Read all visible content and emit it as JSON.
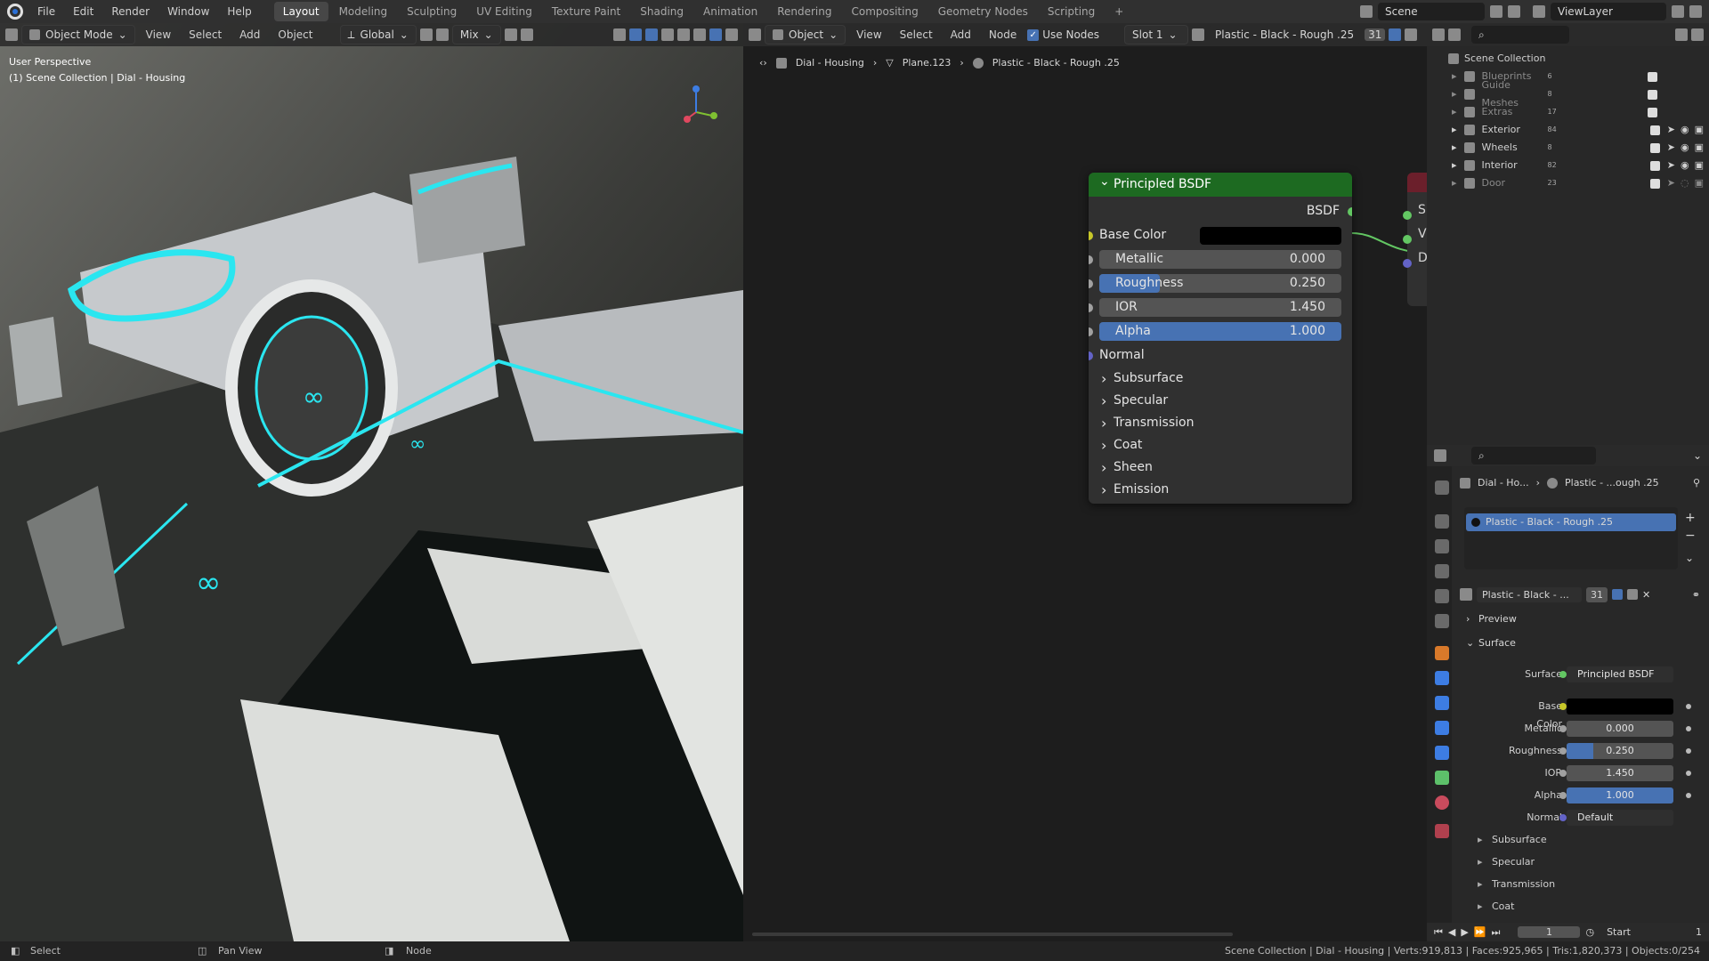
{
  "topbar": {
    "menus": [
      "File",
      "Edit",
      "Render",
      "Window",
      "Help"
    ],
    "workspaces": [
      "Layout",
      "Modeling",
      "Sculpting",
      "UV Editing",
      "Texture Paint",
      "Shading",
      "Animation",
      "Rendering",
      "Compositing",
      "Geometry Nodes",
      "Scripting"
    ],
    "active_workspace": "Layout",
    "add_tab": "+",
    "scene": "Scene",
    "view_layer": "ViewLayer"
  },
  "viewport": {
    "mode": "Object Mode",
    "menus": [
      "View",
      "Select",
      "Add",
      "Object"
    ],
    "transform": "Global",
    "snap": "Mix",
    "perspective": "User Perspective",
    "collection_path": "(1) Scene Collection | Dial - Housing"
  },
  "node_editor": {
    "object_type": "Object",
    "menus": [
      "View",
      "Select",
      "Add",
      "Node"
    ],
    "use_nodes_label": "Use Nodes",
    "slot": "Slot 1",
    "material": "Plastic - Black - Rough .25",
    "user_count": "31",
    "breadcrumb": [
      "Dial - Housing",
      "Plane.123",
      "Plastic - Black - Rough .25"
    ],
    "node": {
      "title": "Principled BSDF",
      "output": "BSDF",
      "base_color_label": "Base Color",
      "metallic": {
        "label": "Metallic",
        "value": "0.000"
      },
      "roughness": {
        "label": "Roughness",
        "value": "0.250"
      },
      "ior": {
        "label": "IOR",
        "value": "1.450"
      },
      "alpha": {
        "label": "Alpha",
        "value": "1.000"
      },
      "normal_label": "Normal",
      "panels": [
        "Subsurface",
        "Specular",
        "Transmission",
        "Coat",
        "Sheen",
        "Emission"
      ]
    },
    "output_node_sockets": [
      "S",
      "V",
      "D"
    ]
  },
  "outliner": {
    "root": "Scene Collection",
    "items": [
      {
        "name": "Blueprints",
        "count": "6"
      },
      {
        "name": "Guide Meshes",
        "count": "8"
      },
      {
        "name": "Extras",
        "count": "17"
      },
      {
        "name": "Exterior",
        "count": "84"
      },
      {
        "name": "Wheels",
        "count": "8"
      },
      {
        "name": "Interior",
        "count": "82"
      },
      {
        "name": "Door",
        "count": "23"
      }
    ]
  },
  "properties": {
    "breadcrumb_object": "Dial - Ho...",
    "breadcrumb_material": "Plastic - ...ough .25",
    "slot_name": "Plastic - Black - Rough .25",
    "material_field": "Plastic - Black - ...",
    "user_count": "31",
    "preview_label": "Preview",
    "surface_panel": "Surface",
    "surface_label": "Surface",
    "surface_value": "Principled BSDF",
    "base_color_label": "Base Color",
    "metallic": {
      "label": "Metallic",
      "value": "0.000"
    },
    "roughness": {
      "label": "Roughness",
      "value": "0.250"
    },
    "ior": {
      "label": "IOR",
      "value": "1.450"
    },
    "alpha": {
      "label": "Alpha",
      "value": "1.000"
    },
    "normal": {
      "label": "Normal",
      "value": "Default"
    },
    "subpanels": [
      "Subsurface",
      "Specular",
      "Transmission",
      "Coat"
    ]
  },
  "timeline": {
    "frame": "1",
    "start_label": "Start",
    "start_value": "1"
  },
  "statusbar": {
    "left": [
      "Select",
      "Pan View",
      "Node"
    ],
    "right": "Scene Collection | Dial - Housing | Verts:919,813 | Faces:925,965 | Tris:1,820,373 | Objects:0/254"
  }
}
